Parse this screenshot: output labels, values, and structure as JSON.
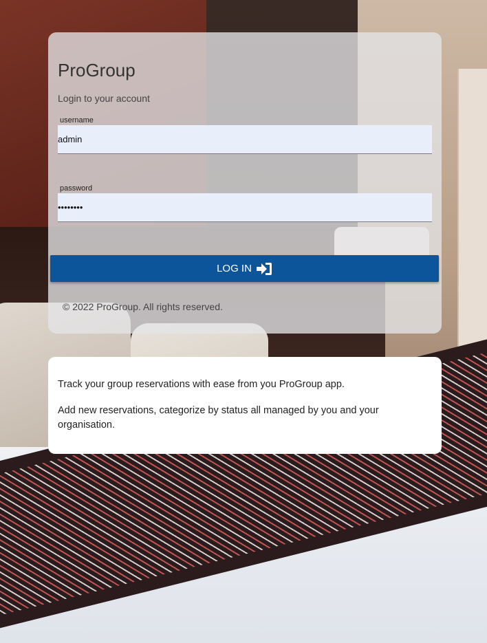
{
  "app": {
    "title": "ProGroup",
    "subtitle": "Login to your account"
  },
  "form": {
    "username_label": "username",
    "username_value": "admin",
    "password_label": "password",
    "password_value": "••••••••",
    "login_label": "LOG IN",
    "login_icon": "sign-in-icon"
  },
  "footer": {
    "copyright": "© 2022 ProGroup. All rights reserved."
  },
  "info": {
    "line1": "Track your group reservations with ease from you ProGroup app.",
    "line2": "Add new reservations, categorize by status all managed by you and your organisation."
  },
  "colors": {
    "primary_button": "#0d559b",
    "card_background": "#e4e4e7",
    "input_background": "#e8eefa"
  }
}
